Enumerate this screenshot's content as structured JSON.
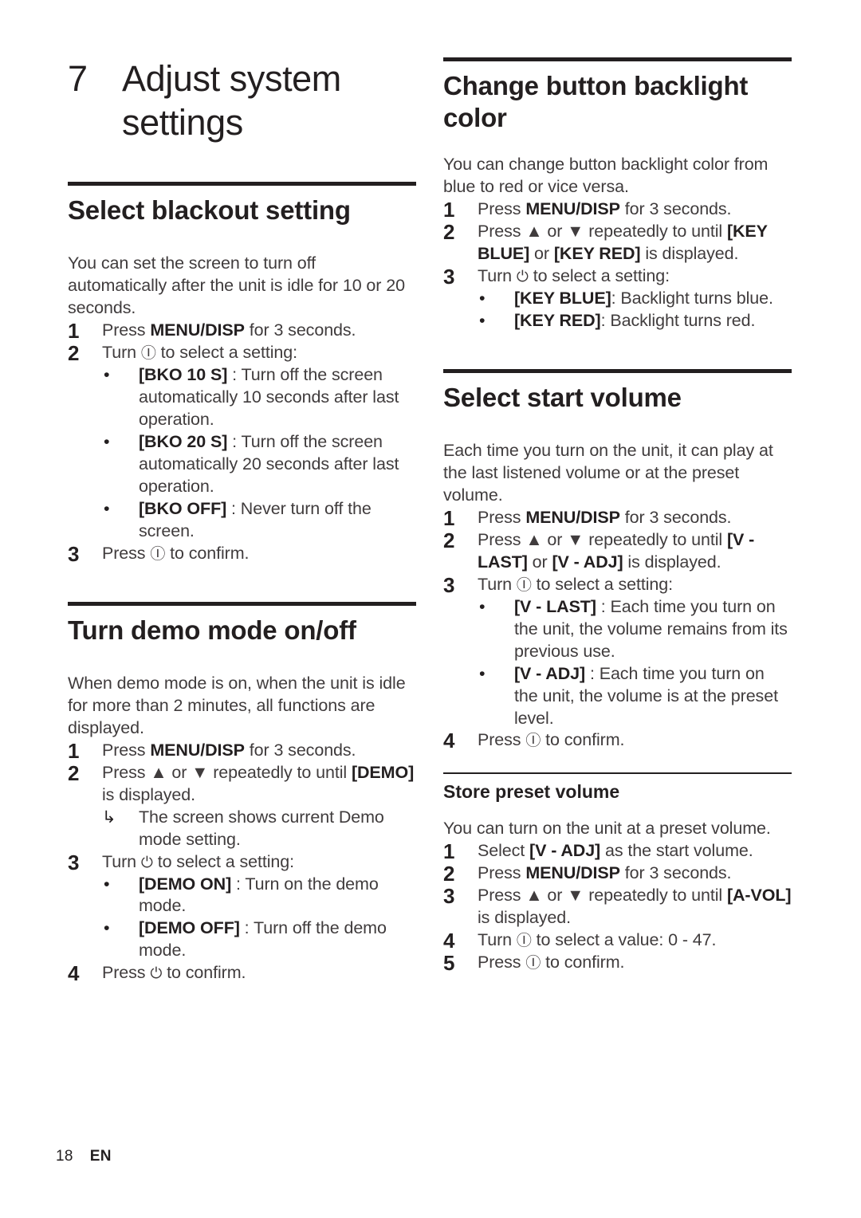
{
  "chapter": {
    "number": "7",
    "title": "Adjust system settings"
  },
  "symbols": {
    "knob": "Ⓘ",
    "power": "⏻",
    "up": "▲",
    "down": "▼",
    "bullet": "•",
    "result_arrow": "↳"
  },
  "left_column": {
    "sections": [
      {
        "title": "Select blackout setting",
        "intro": "You can set the screen to turn off automatically after the unit is idle for 10 or 20 seconds.",
        "steps": [
          {
            "num": "1",
            "pre": "Press ",
            "bold": "MENU/DISP",
            "post": " for 3 seconds."
          },
          {
            "num": "2",
            "pre": "Turn ",
            "symbol": "knob",
            "post": " to select a setting:",
            "bullets": [
              {
                "bold": "[BKO 10 S]",
                "text": " : Turn off the screen automatically 10 seconds after last operation."
              },
              {
                "bold": "[BKO 20 S]",
                "text": " : Turn off the screen automatically 20 seconds after last operation."
              },
              {
                "bold": "[BKO OFF]",
                "text": " : Never turn off the screen."
              }
            ]
          },
          {
            "num": "3",
            "pre": "Press ",
            "symbol": "knob",
            "post": " to confirm."
          }
        ]
      },
      {
        "title": "Turn demo mode on/off",
        "intro": "When demo mode is on, when the unit is idle for more than 2 minutes, all functions are displayed.",
        "steps": [
          {
            "num": "1",
            "pre": "Press ",
            "bold": "MENU/DISP",
            "post": " for 3 seconds."
          },
          {
            "num": "2",
            "pre": "Press ▲ or ▼ repeatedly to until ",
            "bold": "[DEMO]",
            "post": " is displayed.",
            "result": "The screen shows current Demo mode setting."
          },
          {
            "num": "3",
            "pre": "Turn ",
            "symbol": "power",
            "post": " to select a setting:",
            "bullets": [
              {
                "bold": "[DEMO ON]",
                "text": " : Turn on the demo mode."
              },
              {
                "bold": "[DEMO OFF]",
                "text": " : Turn off the demo mode."
              }
            ]
          },
          {
            "num": "4",
            "pre": "Press ",
            "symbol": "power",
            "post": " to confirm."
          }
        ]
      }
    ]
  },
  "right_column": {
    "sections": [
      {
        "title": "Change button backlight color",
        "intro": "You can change button backlight color from blue to red or vice versa.",
        "steps": [
          {
            "num": "1",
            "pre": "Press ",
            "bold": "MENU/DISP",
            "post": " for 3 seconds."
          },
          {
            "num": "2",
            "pre": "Press ▲ or ▼ repeatedly to until ",
            "bold": "[KEY BLUE]",
            "mid": " or ",
            "bold2": "[KEY RED]",
            "post": " is displayed."
          },
          {
            "num": "3",
            "pre": "Turn ",
            "symbol": "power",
            "post": " to select a setting:",
            "bullets": [
              {
                "bold": "[KEY BLUE]",
                "text": ": Backlight turns blue."
              },
              {
                "bold": "[KEY RED]",
                "text": ": Backlight turns red."
              }
            ]
          }
        ]
      },
      {
        "title": "Select start volume",
        "intro": "Each time you turn on the unit, it can play at the last listened volume or at the preset volume.",
        "steps": [
          {
            "num": "1",
            "pre": "Press ",
            "bold": "MENU/DISP",
            "post": " for 3 seconds."
          },
          {
            "num": "2",
            "pre": "Press ▲ or ▼ repeatedly to until ",
            "bold": "[V - LAST]",
            "mid": " or ",
            "bold2": "[V - ADJ]",
            "post": " is displayed."
          },
          {
            "num": "3",
            "pre": "Turn ",
            "symbol": "knob",
            "post": " to select a setting:",
            "bullets": [
              {
                "bold": "[V - LAST]",
                "text": " : Each time you turn on the unit, the volume remains from its previous use."
              },
              {
                "bold": "[V - ADJ]",
                "text": " : Each time you turn on the unit, the volume is at the preset level."
              }
            ]
          },
          {
            "num": "4",
            "pre": "Press ",
            "symbol": "knob",
            "post": " to confirm."
          }
        ],
        "subsection": {
          "title": "Store preset volume",
          "intro": "You can turn on the unit at a preset volume.",
          "steps": [
            {
              "num": "1",
              "pre": "Select ",
              "bold": "[V - ADJ]",
              "post": " as the start volume."
            },
            {
              "num": "2",
              "pre": "Press ",
              "bold": "MENU/DISP",
              "post": " for 3 seconds."
            },
            {
              "num": "3",
              "pre": "Press ▲ or ▼ repeatedly to until ",
              "bold": "[A-VOL]",
              "post": " is displayed."
            },
            {
              "num": "4",
              "pre": "Turn ",
              "symbol": "knob",
              "post": " to select a value: 0 - 47."
            },
            {
              "num": "5",
              "pre": "Press ",
              "symbol": "knob",
              "post": " to confirm."
            }
          ]
        }
      }
    ]
  },
  "footer": {
    "page_number": "18",
    "language": "EN"
  }
}
